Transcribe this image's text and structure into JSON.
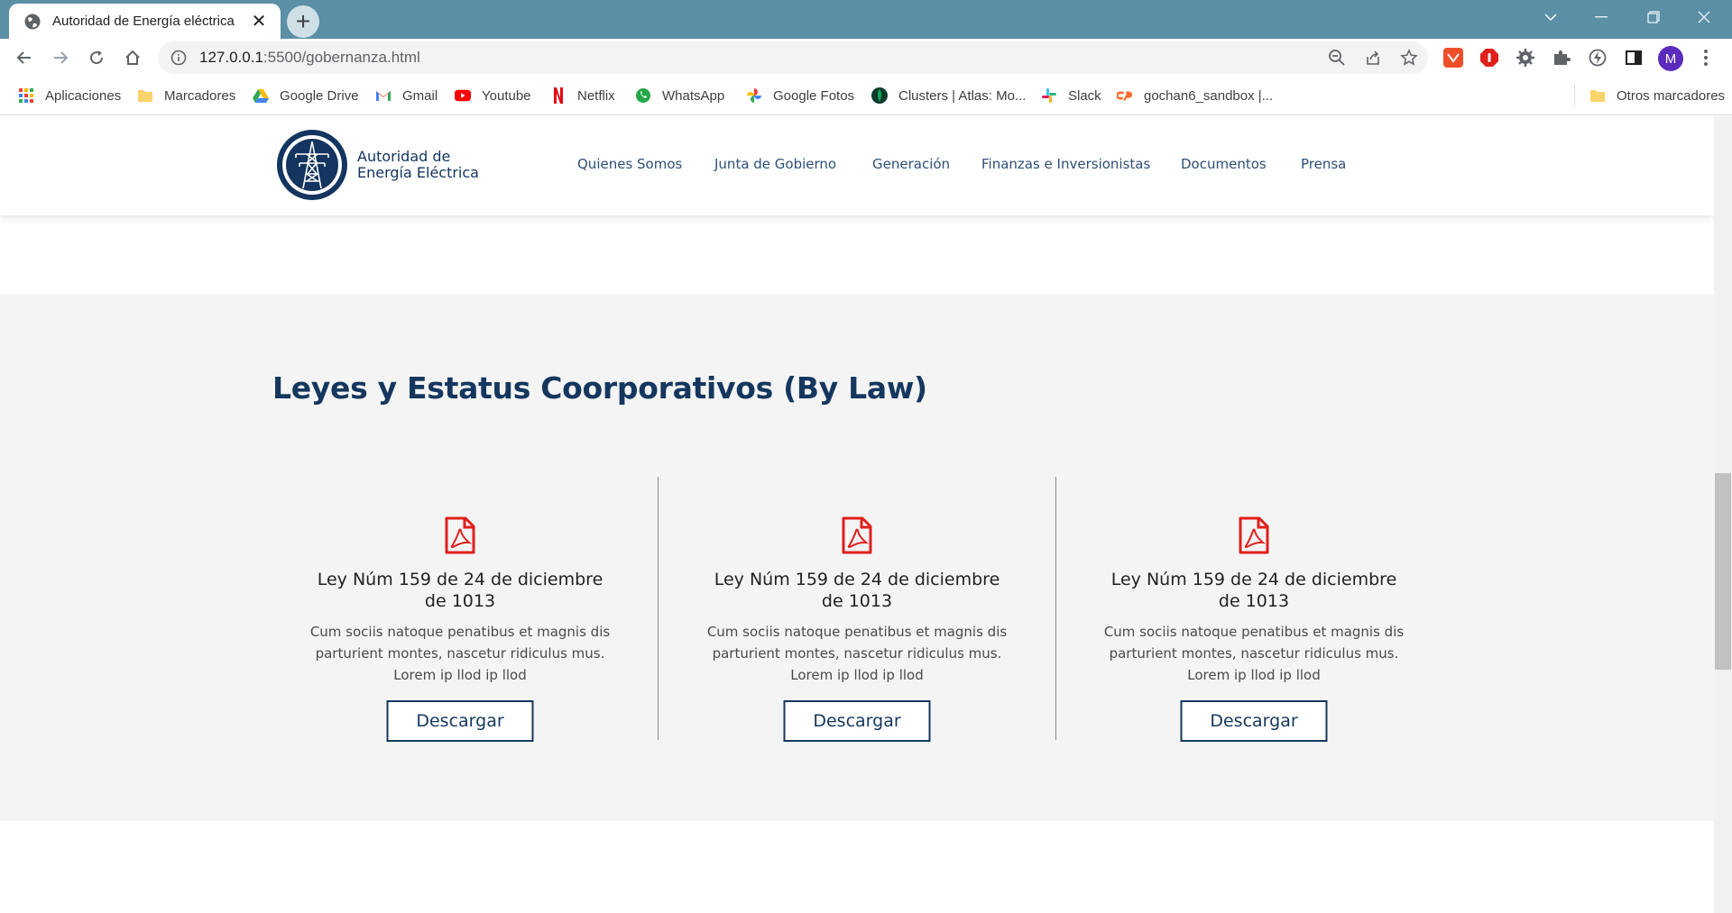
{
  "browser": {
    "tab_title": "Autoridad de Energía eléctrica",
    "tab_close": "✕",
    "new_tab": "+",
    "url_host": "127.0.0.1",
    "url_path": ":5500/gobernanza.html",
    "avatar_letter": "M",
    "bookmarks": [
      {
        "label": "Aplicaciones",
        "icon": "apps-grid-icon"
      },
      {
        "label": "Marcadores",
        "icon": "folder-icon"
      },
      {
        "label": "Google Drive",
        "icon": "google-drive-icon"
      },
      {
        "label": "Gmail",
        "icon": "gmail-icon"
      },
      {
        "label": "Youtube",
        "icon": "youtube-icon"
      },
      {
        "label": "Netflix",
        "icon": "netflix-icon"
      },
      {
        "label": "WhatsApp",
        "icon": "whatsapp-icon"
      },
      {
        "label": "Google Fotos",
        "icon": "google-photos-icon"
      },
      {
        "label": "Clusters | Atlas: Mo...",
        "icon": "mongodb-leaf-icon"
      },
      {
        "label": "Slack",
        "icon": "slack-icon"
      },
      {
        "label": "gochan6_sandbox |...",
        "icon": "cpanel-icon"
      }
    ],
    "other_bookmarks": "Otros marcadores"
  },
  "site": {
    "brand_line1": "Autoridad de",
    "brand_line2": "Energía Eléctrica",
    "nav": [
      "Quienes Somos",
      "Junta de Gobierno",
      "Generación",
      "Finanzas e Inversionistas",
      "Documentos",
      "Prensa"
    ]
  },
  "section": {
    "title": "Leyes y Estatus Coorporativos (By Law)",
    "cards": [
      {
        "title": "Ley Núm 159 de 24 de diciembre de 1013",
        "text": "Cum sociis natoque penatibus et magnis dis parturient montes, nascetur ridiculus mus. Lorem ip llod ip llod",
        "button": "Descargar"
      },
      {
        "title": "Ley Núm 159 de 24 de diciembre de 1013",
        "text": "Cum sociis natoque penatibus et magnis dis parturient montes, nascetur ridiculus mus. Lorem ip llod ip llod",
        "button": "Descargar"
      },
      {
        "title": "Ley Núm 159 de 24 de diciembre de 1013",
        "text": "Cum sociis natoque penatibus et magnis dis parturient montes, nascetur ridiculus mus. Lorem ip llod ip llod",
        "button": "Descargar"
      }
    ]
  },
  "colors": {
    "tabstrip": "#5a8fa5",
    "brand_navy": "#15375f",
    "pdf_red": "#e0201b",
    "section_bg": "#f4f4f4"
  }
}
